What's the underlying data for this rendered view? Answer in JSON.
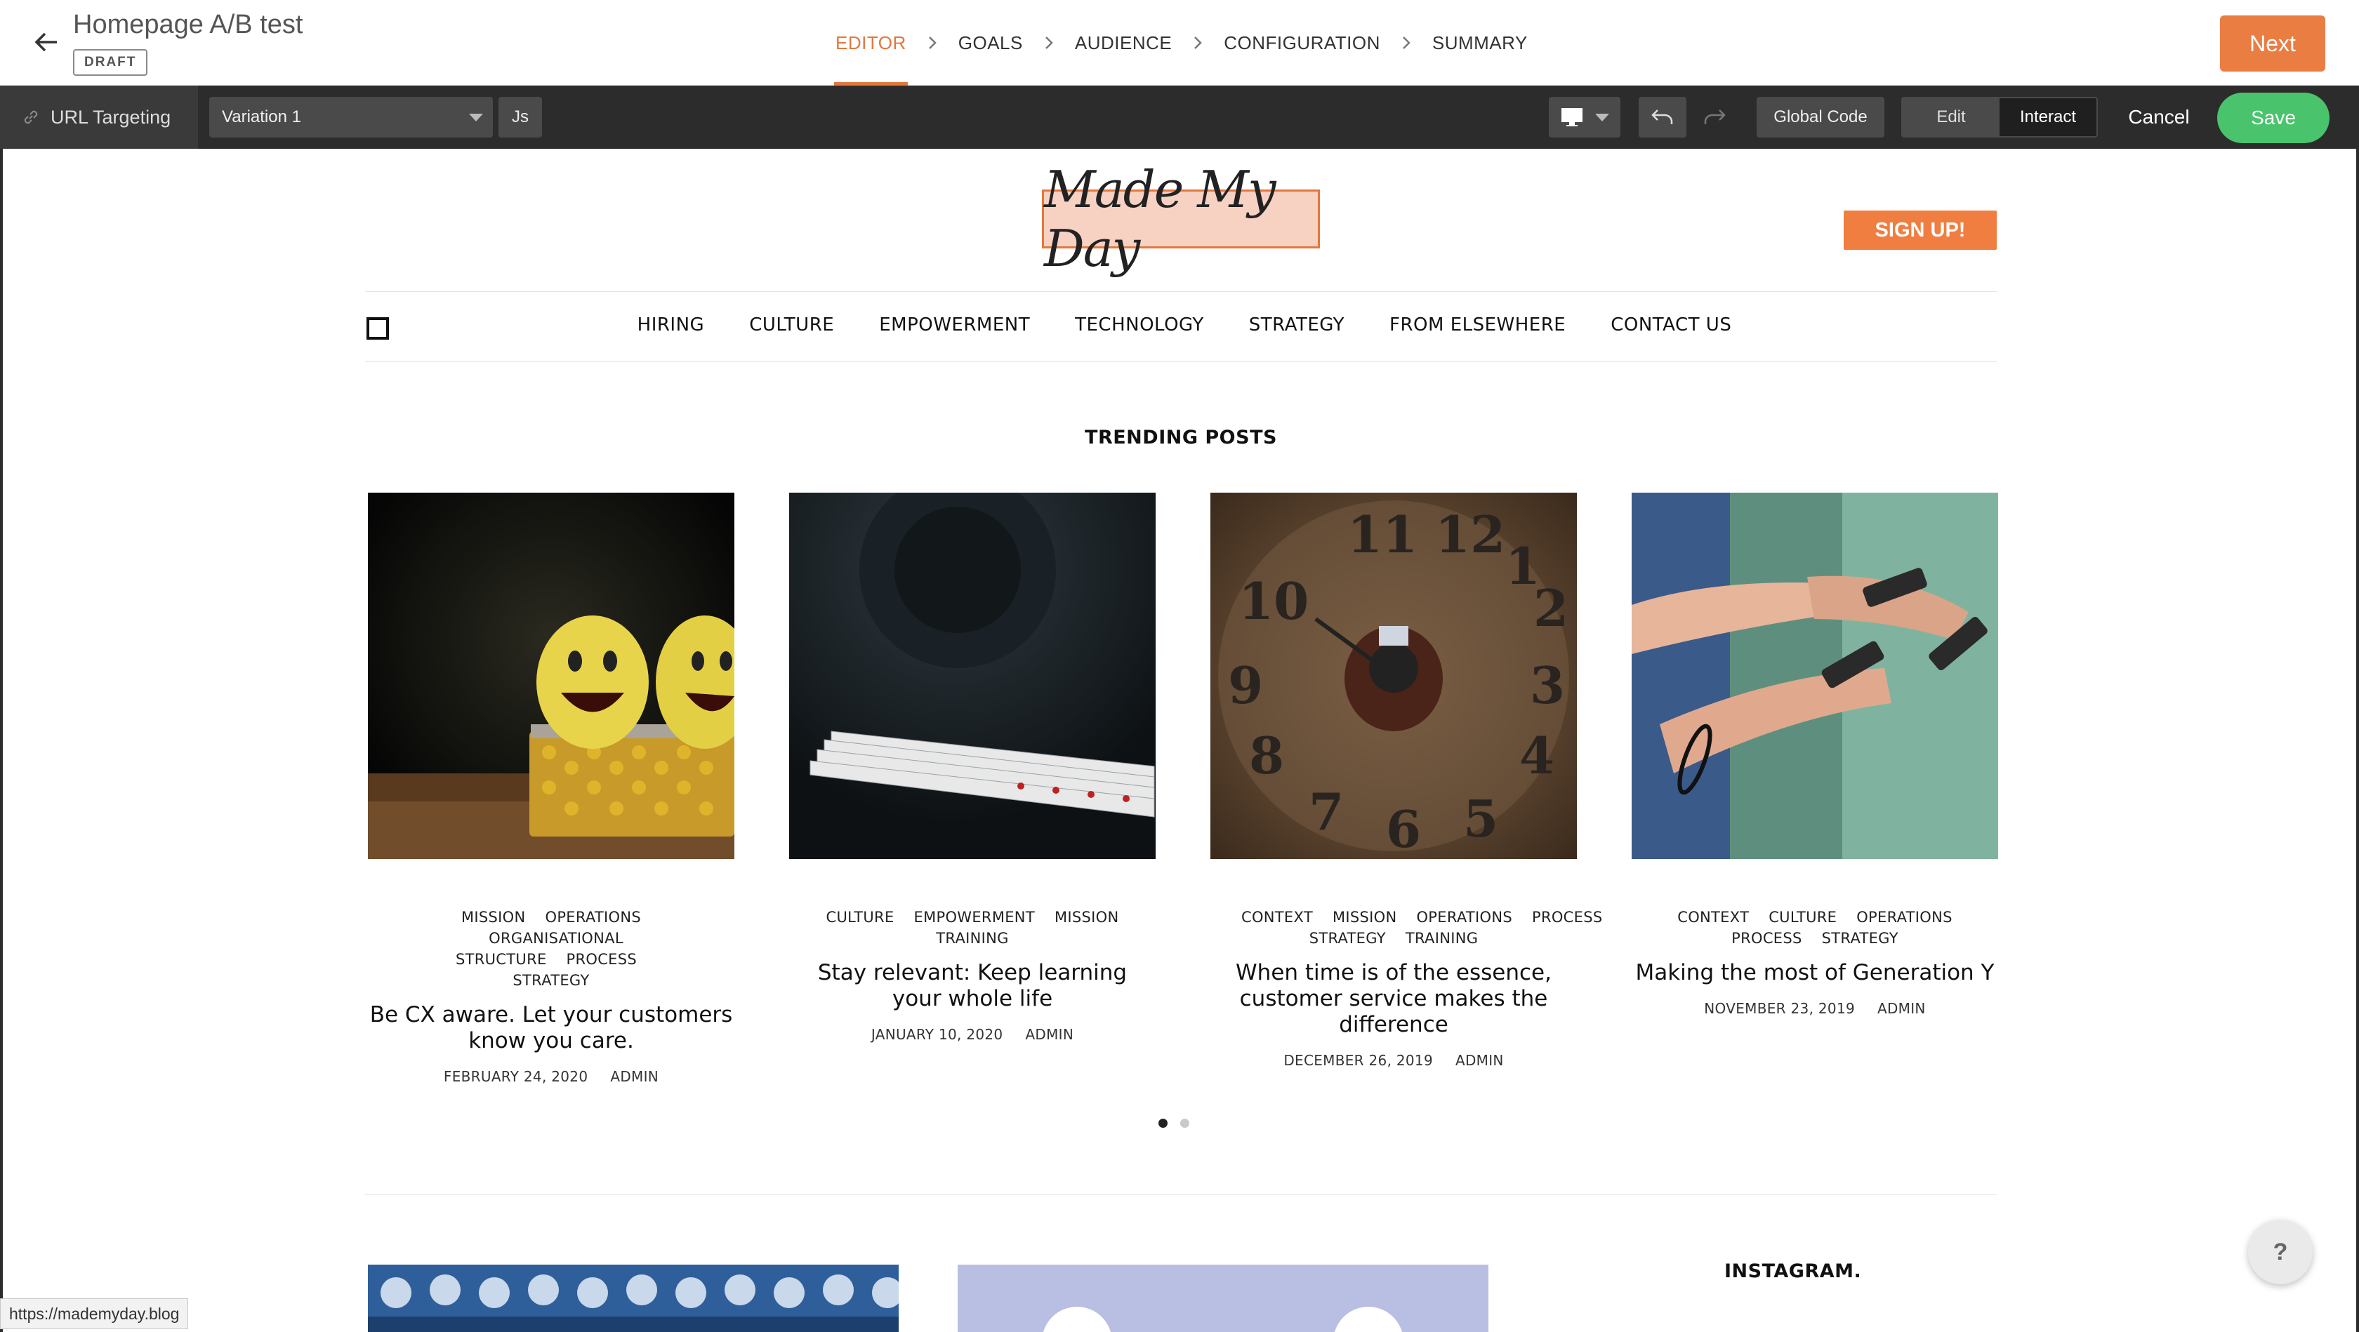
{
  "header": {
    "title": "Homepage A/B test",
    "status_badge": "DRAFT",
    "steps": [
      {
        "label": "EDITOR",
        "active": true
      },
      {
        "label": "GOALS",
        "active": false
      },
      {
        "label": "AUDIENCE",
        "active": false
      },
      {
        "label": "CONFIGURATION",
        "active": false
      },
      {
        "label": "SUMMARY",
        "active": false
      }
    ],
    "next_label": "Next"
  },
  "toolbar": {
    "url_targeting": "URL Targeting",
    "variation": "Variation 1",
    "js": "Js",
    "global_code": "Global Code",
    "mode_edit": "Edit",
    "mode_interact": "Interact",
    "cancel": "Cancel",
    "save": "Save"
  },
  "site": {
    "logo": "Made My Day",
    "signup": "SIGN UP!",
    "nav": [
      "HIRING",
      "CULTURE",
      "EMPOWERMENT",
      "TECHNOLOGY",
      "STRATEGY",
      "FROM ELSEWHERE",
      "CONTACT US"
    ],
    "trending_heading": "TRENDING POSTS",
    "posts": [
      {
        "tags_line1": [
          "MISSION",
          "OPERATIONS"
        ],
        "tags_line2": [
          "ORGANISATIONAL STRUCTURE",
          "PROCESS"
        ],
        "tags_line3": [
          "STRATEGY"
        ],
        "title": "Be CX aware. Let your customers know you care.",
        "date": "FEBRUARY 24, 2020",
        "author": "ADMIN"
      },
      {
        "tags_line1": [
          "CULTURE",
          "EMPOWERMENT",
          "MISSION"
        ],
        "tags_line2": [
          "TRAINING"
        ],
        "tags_line3": [],
        "title": "Stay relevant: Keep learning your whole life",
        "date": "JANUARY 10, 2020",
        "author": "ADMIN"
      },
      {
        "tags_line1": [
          "CONTEXT",
          "MISSION",
          "OPERATIONS",
          "PROCESS"
        ],
        "tags_line2": [
          "STRATEGY",
          "TRAINING"
        ],
        "tags_line3": [],
        "title": "When time is of the essence, customer service makes the difference",
        "date": "DECEMBER 26, 2019",
        "author": "ADMIN"
      },
      {
        "tags_line1": [
          "CONTEXT",
          "CULTURE",
          "OPERATIONS"
        ],
        "tags_line2": [
          "PROCESS",
          "STRATEGY"
        ],
        "tags_line3": [],
        "title": "Making the most of Generation Y",
        "date": "NOVEMBER 23, 2019",
        "author": "ADMIN"
      }
    ],
    "instagram_heading": "INSTAGRAM."
  },
  "help_label": "?",
  "status_url": "https://mademyday.blog",
  "colors": {
    "accent": "#e3773d",
    "next_button": "#ea7d42",
    "save_button": "#49c46d",
    "toolbar_bg": "#2c2c2c"
  }
}
